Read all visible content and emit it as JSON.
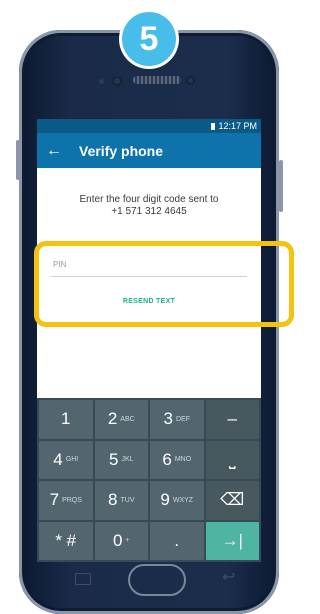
{
  "step_badge": "5",
  "status_bar": {
    "time": "12:17 PM"
  },
  "app_bar": {
    "title": "Verify phone",
    "back_icon": "arrow-left-icon"
  },
  "content": {
    "instructions_line1": "Enter the four digit code sent to",
    "instructions_line2": "+1 571 312 4645",
    "pin_placeholder": "PIN",
    "resend_label": "RESEND TEXT"
  },
  "keyboard": {
    "rows": [
      [
        {
          "main": "1",
          "sub": ""
        },
        {
          "main": "2",
          "sub": "ABC"
        },
        {
          "main": "3",
          "sub": "DEF"
        },
        {
          "main": "–",
          "sub": ""
        }
      ],
      [
        {
          "main": "4",
          "sub": "GHI"
        },
        {
          "main": "5",
          "sub": "JKL"
        },
        {
          "main": "6",
          "sub": "MNO"
        },
        {
          "main": "⎵",
          "sub": ""
        }
      ],
      [
        {
          "main": "7",
          "sub": "PRQS"
        },
        {
          "main": "8",
          "sub": "TUV"
        },
        {
          "main": "9",
          "sub": "WXYZ"
        },
        {
          "main": "⌫",
          "sub": ""
        }
      ],
      [
        {
          "main": "* #",
          "sub": ""
        },
        {
          "main": "0",
          "sub": "+"
        },
        {
          "main": ".",
          "sub": ""
        },
        {
          "main": "→|",
          "sub": ""
        }
      ]
    ]
  },
  "colors": {
    "badge": "#48bde9",
    "status_bar": "#0a5a88",
    "app_bar": "#0e72ab",
    "accent_green": "#1db57c",
    "highlight": "#f5c20f",
    "keyboard_bg": "#374a59",
    "key": "#53666f",
    "key_go": "#4eb5a3"
  }
}
